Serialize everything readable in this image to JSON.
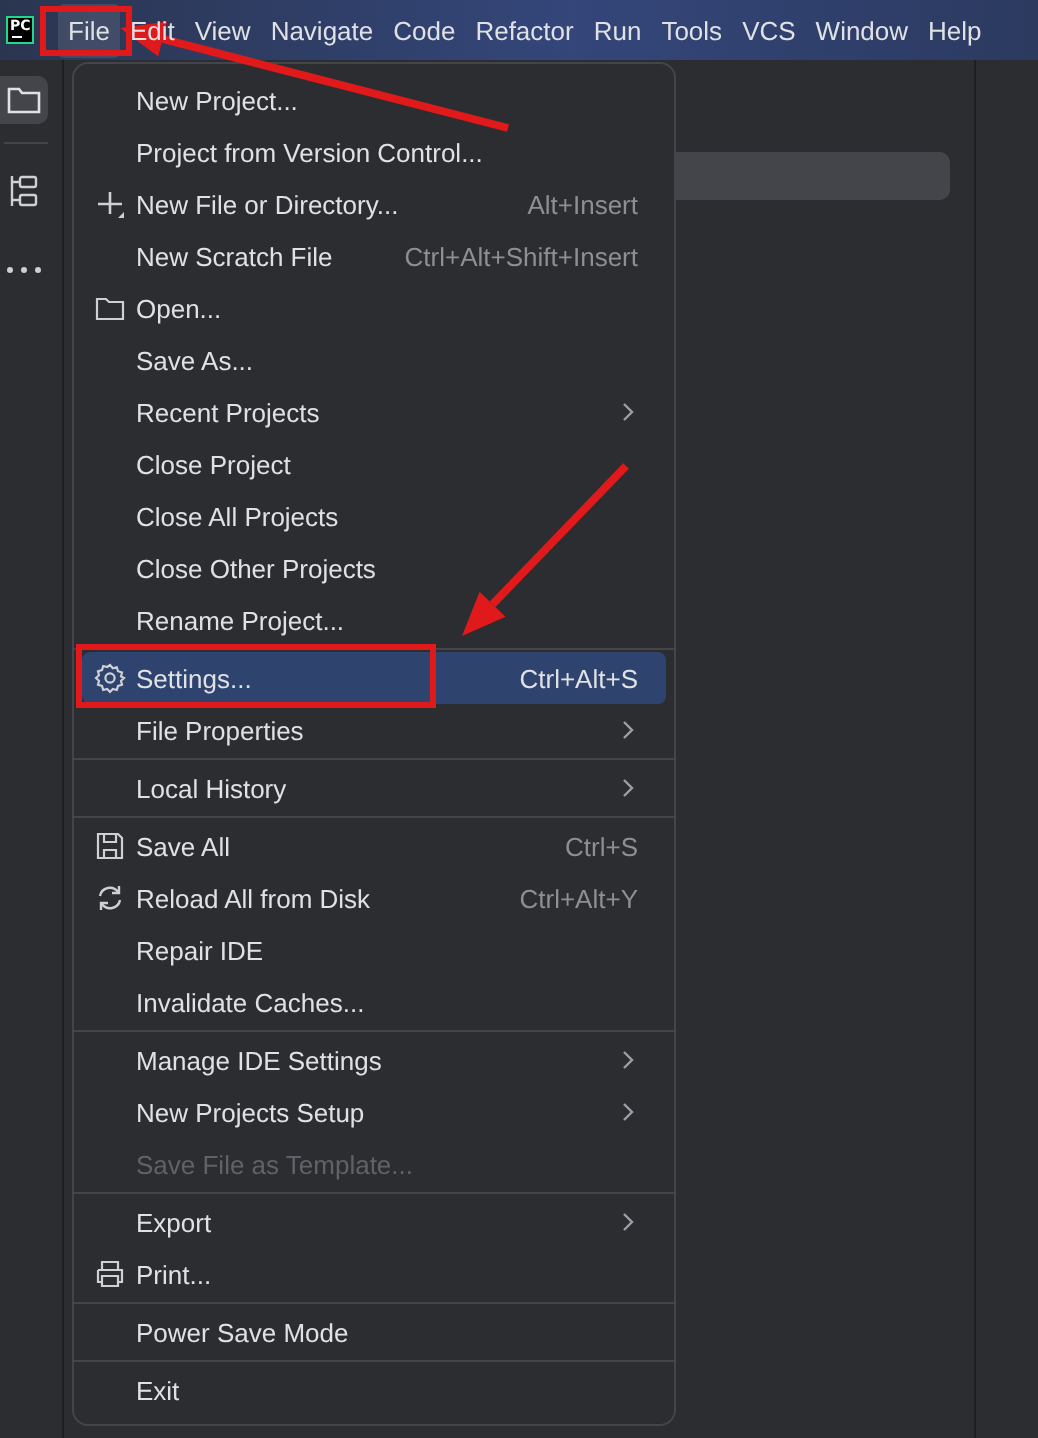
{
  "logo": "PC",
  "menu_bar": [
    {
      "label": "File",
      "selected": true,
      "highlighted": true
    },
    {
      "label": "Edit",
      "selected": false,
      "highlighted": false
    },
    {
      "label": "View",
      "selected": false,
      "highlighted": false
    },
    {
      "label": "Navigate",
      "selected": false,
      "highlighted": false
    },
    {
      "label": "Code",
      "selected": false,
      "highlighted": false
    },
    {
      "label": "Refactor",
      "selected": false,
      "highlighted": false
    },
    {
      "label": "Run",
      "selected": false,
      "highlighted": false
    },
    {
      "label": "Tools",
      "selected": false,
      "highlighted": false
    },
    {
      "label": "VCS",
      "selected": false,
      "highlighted": false
    },
    {
      "label": "Window",
      "selected": false,
      "highlighted": false
    },
    {
      "label": "Help",
      "selected": false,
      "highlighted": false
    }
  ],
  "tool_strip": [
    {
      "selected": true
    },
    {
      "selected": false
    },
    {
      "selected": false
    }
  ],
  "file_menu": [
    {
      "kind": "item",
      "label": "New Project...",
      "selected": false,
      "disabled": false,
      "submenu": false,
      "highlighted": false
    },
    {
      "kind": "item",
      "label": "Project from Version Control...",
      "selected": false,
      "disabled": false,
      "submenu": false,
      "highlighted": false
    },
    {
      "kind": "item",
      "label": "New File or Directory...",
      "shortcut": "Alt+Insert",
      "selected": false,
      "disabled": false,
      "submenu": false,
      "highlighted": false
    },
    {
      "kind": "item",
      "label": "New Scratch File",
      "shortcut": "Ctrl+Alt+Shift+Insert",
      "selected": false,
      "disabled": false,
      "submenu": false,
      "highlighted": false
    },
    {
      "kind": "item",
      "label": "Open...",
      "selected": false,
      "disabled": false,
      "submenu": false,
      "highlighted": false
    },
    {
      "kind": "item",
      "label": "Save As...",
      "selected": false,
      "disabled": false,
      "submenu": false,
      "highlighted": false
    },
    {
      "kind": "item",
      "label": "Recent Projects",
      "selected": false,
      "disabled": false,
      "submenu": true,
      "highlighted": false
    },
    {
      "kind": "item",
      "label": "Close Project",
      "selected": false,
      "disabled": false,
      "submenu": false,
      "highlighted": false
    },
    {
      "kind": "item",
      "label": "Close All Projects",
      "selected": false,
      "disabled": false,
      "submenu": false,
      "highlighted": false
    },
    {
      "kind": "item",
      "label": "Close Other Projects",
      "selected": false,
      "disabled": false,
      "submenu": false,
      "highlighted": false
    },
    {
      "kind": "item",
      "label": "Rename Project...",
      "selected": false,
      "disabled": false,
      "submenu": false,
      "highlighted": false
    },
    {
      "kind": "separator"
    },
    {
      "kind": "item",
      "label": "Settings...",
      "shortcut": "Ctrl+Alt+S",
      "selected": true,
      "disabled": false,
      "submenu": false,
      "highlighted": true
    },
    {
      "kind": "item",
      "label": "File Properties",
      "selected": false,
      "disabled": false,
      "submenu": true,
      "highlighted": false
    },
    {
      "kind": "separator"
    },
    {
      "kind": "item",
      "label": "Local History",
      "selected": false,
      "disabled": false,
      "submenu": true,
      "highlighted": false
    },
    {
      "kind": "separator"
    },
    {
      "kind": "item",
      "label": "Save All",
      "shortcut": "Ctrl+S",
      "selected": false,
      "disabled": false,
      "submenu": false,
      "highlighted": false
    },
    {
      "kind": "item",
      "label": "Reload All from Disk",
      "shortcut": "Ctrl+Alt+Y",
      "selected": false,
      "disabled": false,
      "submenu": false,
      "highlighted": false
    },
    {
      "kind": "item",
      "label": "Repair IDE",
      "selected": false,
      "disabled": false,
      "submenu": false,
      "highlighted": false
    },
    {
      "kind": "item",
      "label": "Invalidate Caches...",
      "selected": false,
      "disabled": false,
      "submenu": false,
      "highlighted": false
    },
    {
      "kind": "separator"
    },
    {
      "kind": "item",
      "label": "Manage IDE Settings",
      "selected": false,
      "disabled": false,
      "submenu": true,
      "highlighted": false
    },
    {
      "kind": "item",
      "label": "New Projects Setup",
      "selected": false,
      "disabled": false,
      "submenu": true,
      "highlighted": false
    },
    {
      "kind": "item",
      "label": "Save File as Template...",
      "selected": false,
      "disabled": true,
      "submenu": false,
      "highlighted": false
    },
    {
      "kind": "separator"
    },
    {
      "kind": "item",
      "label": "Export",
      "selected": false,
      "disabled": false,
      "submenu": true,
      "highlighted": false
    },
    {
      "kind": "item",
      "label": "Print...",
      "selected": false,
      "disabled": false,
      "submenu": false,
      "highlighted": false
    },
    {
      "kind": "separator"
    },
    {
      "kind": "item",
      "label": "Power Save Mode",
      "selected": false,
      "disabled": false,
      "submenu": false,
      "highlighted": false
    },
    {
      "kind": "separator"
    },
    {
      "kind": "item",
      "label": "Exit",
      "selected": false,
      "disabled": false,
      "submenu": false,
      "highlighted": false
    }
  ]
}
